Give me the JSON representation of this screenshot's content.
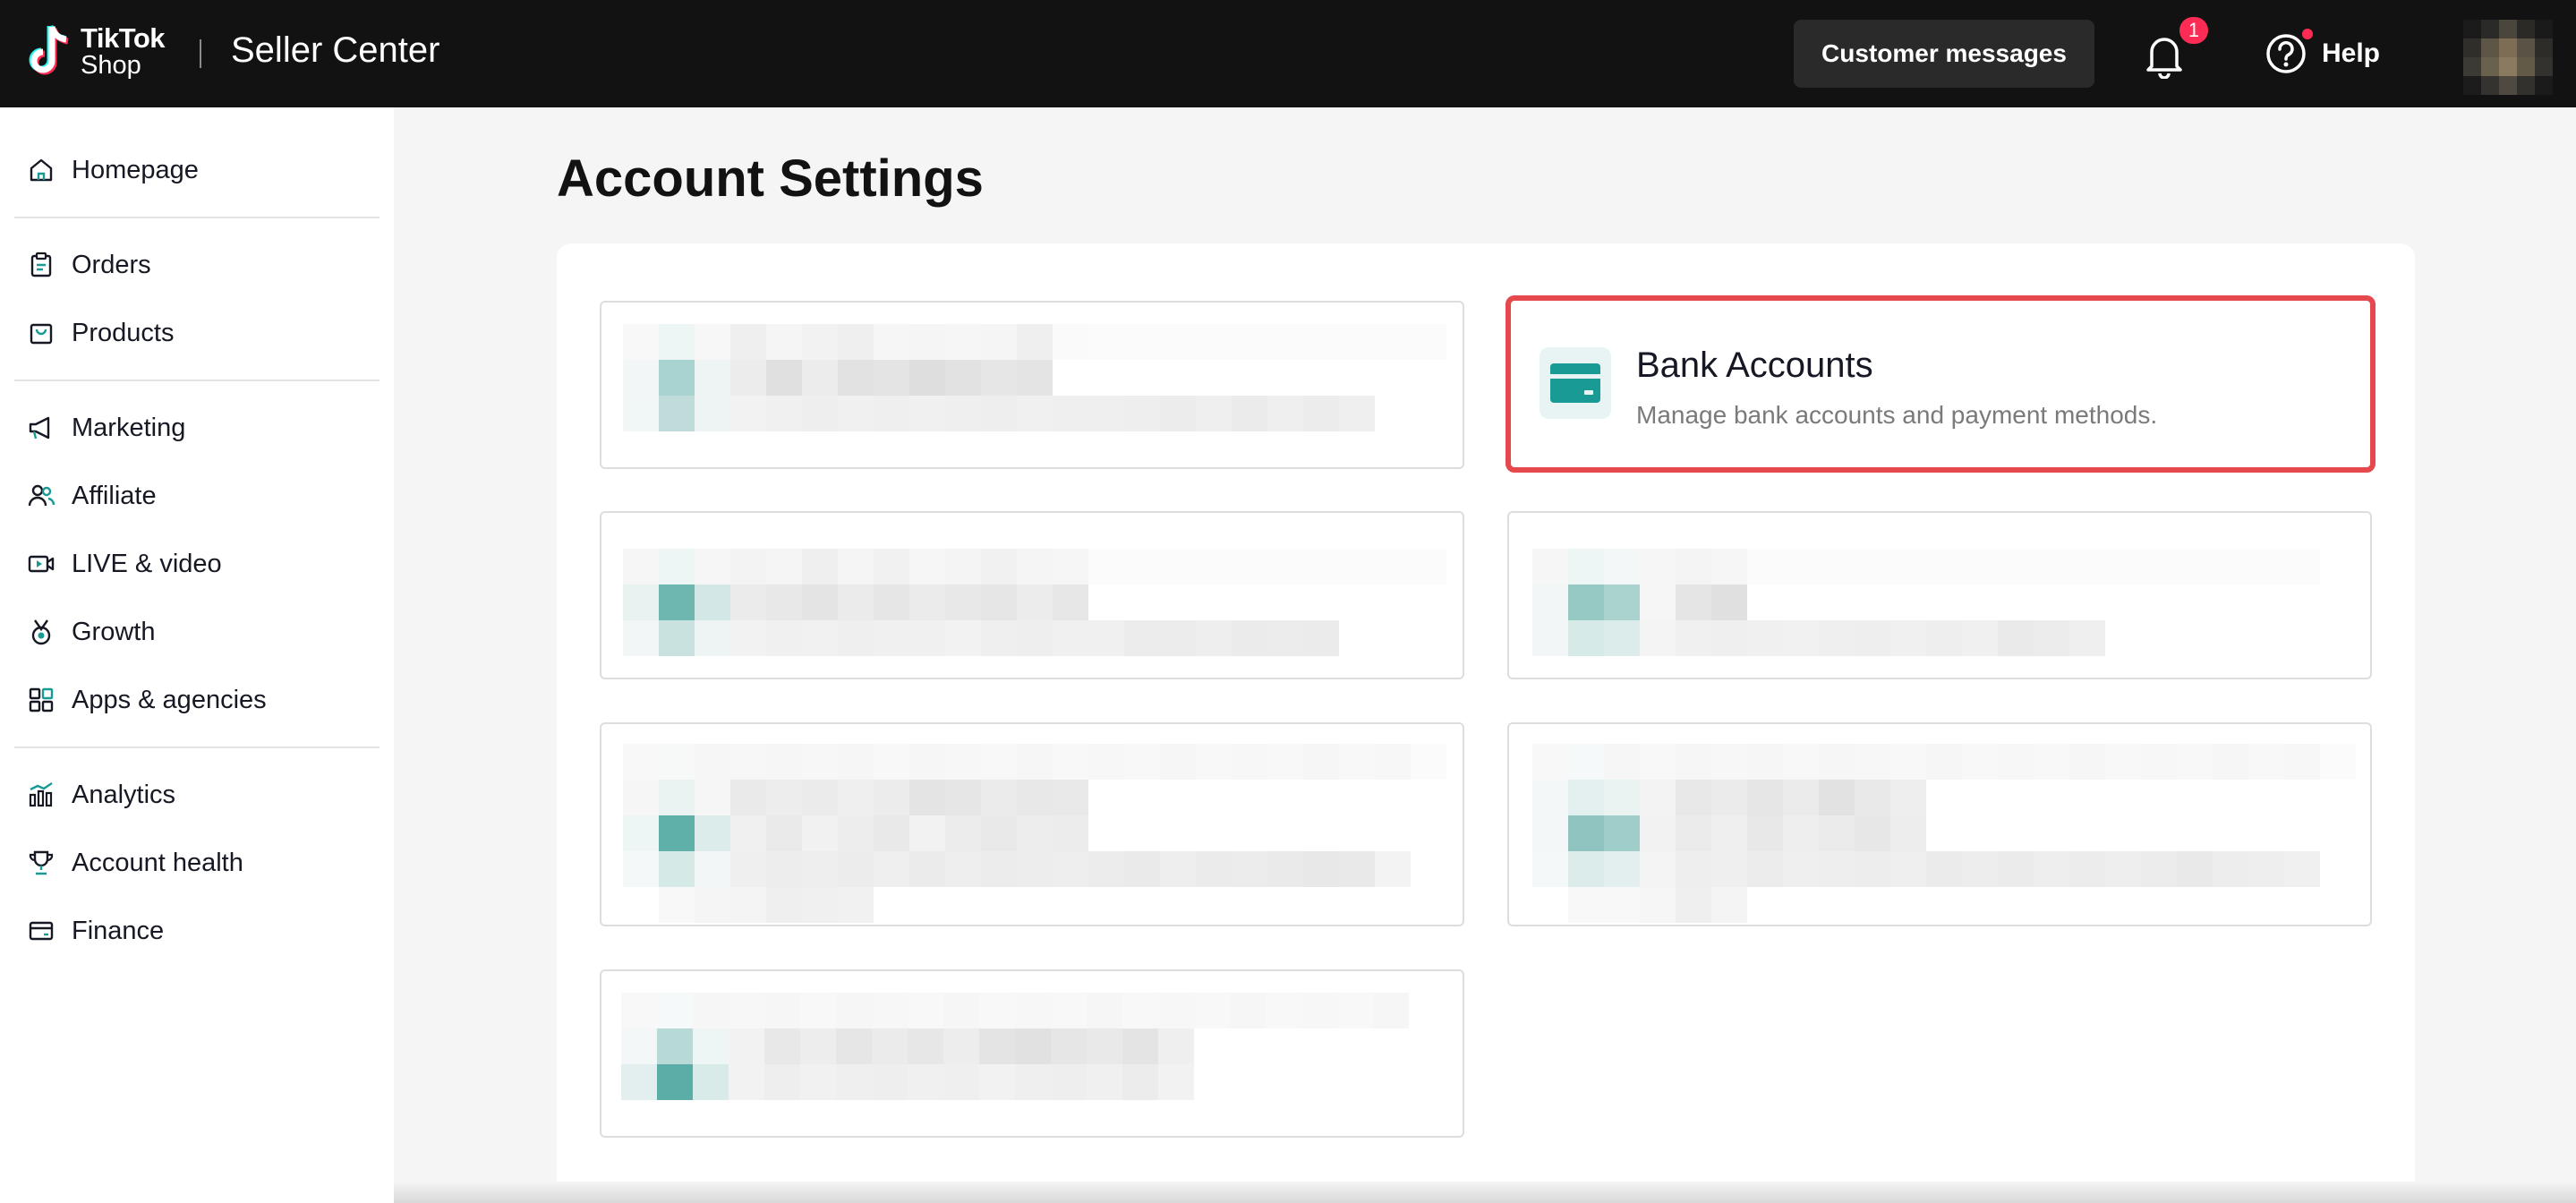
{
  "topbar": {
    "logo_line1": "TikTok",
    "logo_line2": "Shop",
    "app_title": "Seller Center",
    "customer_messages_label": "Customer messages",
    "notification_count": "1",
    "help_label": "Help"
  },
  "sidebar": {
    "items": [
      {
        "label": "Homepage",
        "icon": "home-icon"
      },
      {
        "label": "Orders",
        "icon": "clipboard-icon"
      },
      {
        "label": "Products",
        "icon": "shopping-bag-icon"
      },
      {
        "label": "Marketing",
        "icon": "megaphone-icon"
      },
      {
        "label": "Affiliate",
        "icon": "people-icon"
      },
      {
        "label": "LIVE & video",
        "icon": "video-icon"
      },
      {
        "label": "Growth",
        "icon": "medal-icon"
      },
      {
        "label": "Apps & agencies",
        "icon": "apps-grid-icon"
      },
      {
        "label": "Analytics",
        "icon": "bar-chart-icon"
      },
      {
        "label": "Account health",
        "icon": "trophy-icon"
      },
      {
        "label": "Finance",
        "icon": "wallet-icon"
      }
    ]
  },
  "main": {
    "page_title": "Account Settings",
    "bank_card": {
      "title": "Bank Accounts",
      "description": "Manage bank accounts and payment methods.",
      "icon": "credit-card-icon"
    }
  },
  "colors": {
    "accent_teal": "#1a9a94",
    "highlight_red": "#e5484d",
    "badge_red": "#fe2c55"
  }
}
